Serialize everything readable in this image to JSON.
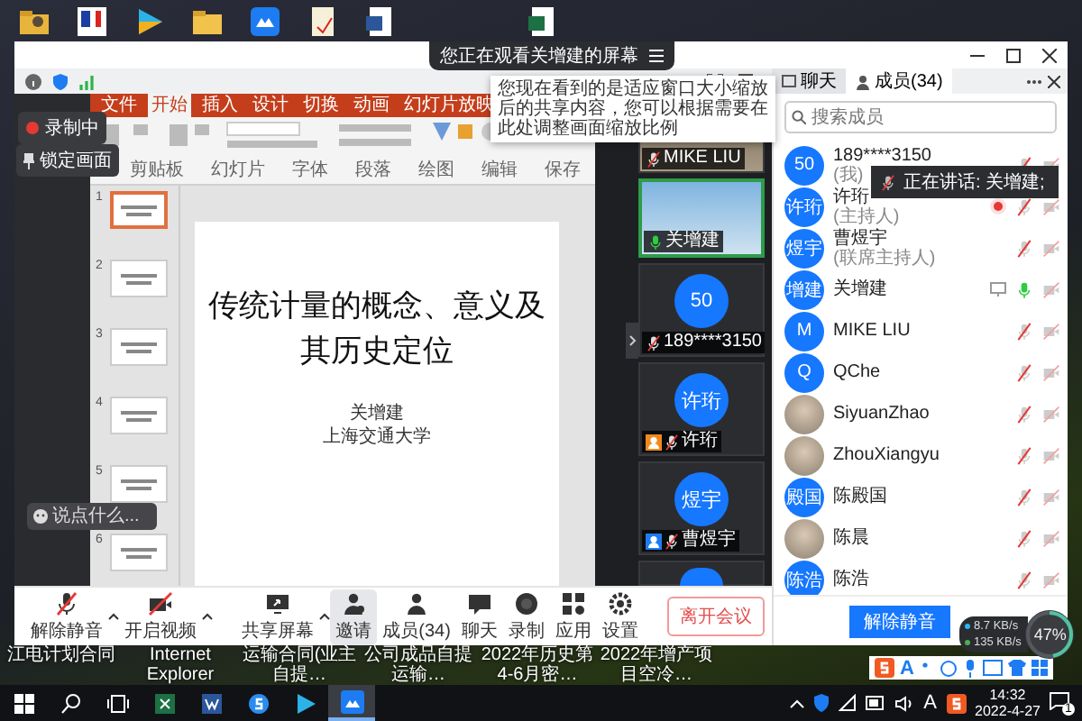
{
  "window": {
    "banner": "您正在观看关增建的屏幕",
    "tooltip": "您现在看到的是适应窗口大小缩放后的共享内容，您可以根据需要在此处调整画面缩放比例"
  },
  "sidebar": {
    "recording": "录制中",
    "lock": "锁定画面",
    "comment_placeholder": "说点什么..."
  },
  "ppt": {
    "tabs": [
      {
        "label": "文件",
        "selected": false
      },
      {
        "label": "开始",
        "selected": true
      },
      {
        "label": "插入",
        "selected": false
      },
      {
        "label": "设计",
        "selected": false
      },
      {
        "label": "切换",
        "selected": false
      },
      {
        "label": "动画",
        "selected": false
      },
      {
        "label": "幻灯片放映",
        "selected": false
      }
    ],
    "groups": [
      "剪贴板",
      "幻灯片",
      "字体",
      "段落",
      "绘图",
      "编辑",
      "保存"
    ],
    "slides": [
      {
        "number": "1",
        "selected": true
      },
      {
        "number": "2",
        "selected": false
      },
      {
        "number": "3",
        "selected": false
      },
      {
        "number": "4",
        "selected": false
      },
      {
        "number": "5",
        "selected": false
      },
      {
        "number": "6",
        "selected": false
      }
    ],
    "slide": {
      "title": "传统计量的概念、意义及其历史定位",
      "author": "关增建",
      "affiliation": "上海交通大学"
    }
  },
  "videos": [
    {
      "kind": "camera",
      "name": "MIKE LIU",
      "muted": true,
      "speaking": false
    },
    {
      "kind": "camera",
      "name": "关增建",
      "muted": false,
      "speaking": true
    },
    {
      "kind": "avatar",
      "avatar": "50",
      "name": "189****3150",
      "muted": true,
      "speaking": false
    },
    {
      "kind": "avatar",
      "avatar": "许珩",
      "name": "许珩",
      "muted": true,
      "speaking": false,
      "color": "#f08a1c"
    },
    {
      "kind": "avatar",
      "avatar": "煜宇",
      "name": "曹煜宇",
      "muted": true,
      "speaking": false,
      "color": "#1e7cf2"
    }
  ],
  "members": {
    "tabs": [
      {
        "label": "聊天",
        "selected": false
      },
      {
        "label": "成员(34)",
        "selected": true
      }
    ],
    "search_placeholder": "搜索成员",
    "list": [
      {
        "kind": "initials",
        "avatar": "50",
        "name": "189****3150",
        "role": "(我)",
        "muted": true,
        "camera": false,
        "recording": false,
        "sharing": false
      },
      {
        "kind": "initials",
        "avatar": "许珩",
        "name": "许珩",
        "role": "(主持人)",
        "muted": true,
        "camera": false,
        "recording": true,
        "sharing": false
      },
      {
        "kind": "initials",
        "avatar": "煜宇",
        "name": "曹煜宇",
        "role": "(联席主持人)",
        "muted": true,
        "camera": false,
        "recording": false,
        "sharing": false
      },
      {
        "kind": "initials",
        "avatar": "增建",
        "name": "关增建",
        "muted": false,
        "camera": false,
        "recording": false,
        "sharing": true
      },
      {
        "kind": "initials",
        "avatar": "M",
        "name": "MIKE LIU",
        "muted": true,
        "camera": false,
        "recording": false,
        "sharing": false
      },
      {
        "kind": "initials",
        "avatar": "Q",
        "name": "QChe",
        "muted": true,
        "camera": false,
        "recording": false,
        "sharing": false
      },
      {
        "kind": "photo",
        "name": "SiyuanZhao",
        "muted": true,
        "camera": false,
        "recording": false,
        "sharing": false
      },
      {
        "kind": "photo",
        "name": "ZhouXiangyu",
        "muted": true,
        "camera": false,
        "recording": false,
        "sharing": false
      },
      {
        "kind": "initials",
        "avatar": "殿国",
        "name": "陈殿国",
        "muted": true,
        "camera": false,
        "recording": false,
        "sharing": false
      },
      {
        "kind": "photo",
        "name": "陈晨",
        "muted": true,
        "camera": false,
        "recording": false,
        "sharing": false
      },
      {
        "kind": "initials",
        "avatar": "陈浩",
        "name": "陈浩",
        "muted": true,
        "camera": false,
        "recording": false,
        "sharing": false
      }
    ],
    "speaking_toast": "正在讲话: 关增建;",
    "unmute_button": "解除静音"
  },
  "toolbar": {
    "items": [
      {
        "kind": "mic",
        "label": "解除静音",
        "off": true,
        "caret": true,
        "selected": false
      },
      {
        "kind": "camera",
        "label": "开启视频",
        "off": true,
        "caret": true,
        "selected": false
      },
      {
        "kind": "share",
        "label": "共享屏幕",
        "caret": true,
        "selected": false
      },
      {
        "kind": "invite",
        "label": "邀请",
        "caret": false,
        "selected": true
      },
      {
        "kind": "members",
        "label": "成员(34)",
        "caret": false,
        "selected": false
      },
      {
        "kind": "chat",
        "label": "聊天",
        "caret": false,
        "selected": false
      },
      {
        "kind": "record",
        "label": "录制",
        "caret": false,
        "selected": false
      },
      {
        "kind": "apps",
        "label": "应用",
        "caret": false,
        "selected": false
      },
      {
        "kind": "settings",
        "label": "设置",
        "caret": false,
        "selected": false
      }
    ],
    "leave": "离开会议"
  },
  "network": {
    "download": "8.7",
    "download_unit": "KB/s",
    "upload": "135",
    "upload_unit": "KB/s",
    "cpu": "47%",
    "level": 0.47
  },
  "desktop": {
    "labels": [
      "江电计划合同",
      "Internet Explorer",
      "运输合同(业主自提…",
      "公司成品自提运输…",
      "2022年历史第4-6月密…",
      "2022年增产项目空冷…"
    ],
    "ime_mode": "A"
  },
  "taskbar": {
    "ime_mode": "A",
    "time": "14:32",
    "date": "2022-4-27",
    "notifications": "1"
  }
}
